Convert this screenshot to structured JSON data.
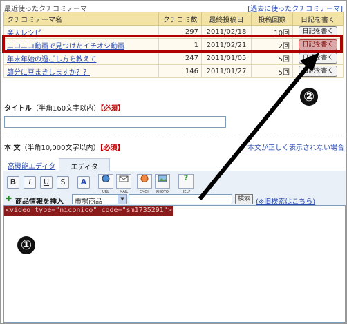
{
  "recent": {
    "title": "最近使ったクチコミテーマ",
    "bracket_open": "[",
    "link": "過去に使ったクチコミテーマ",
    "bracket_close": "]"
  },
  "table": {
    "headers": [
      "クチコミテーマ名",
      "クチコミ数",
      "最終投稿日",
      "投稿回数",
      "日記を書く"
    ],
    "rows": [
      {
        "name": "楽天レシピ",
        "count": "297",
        "date": "2011/02/18",
        "posts": "10回",
        "button": "日記を書く"
      },
      {
        "name": "ニコニコ動画で見つけたイチオシ動画",
        "count": "1",
        "date": "2011/02/21",
        "posts": "2回",
        "button": "日記を書く"
      },
      {
        "name": "年末年始の過ごし方を教えて",
        "count": "247",
        "date": "2011/01/05",
        "posts": "5回",
        "button": "日記を書く"
      },
      {
        "name": "節分に豆まきしますか？？",
        "count": "146",
        "date": "2011/01/27",
        "posts": "5回",
        "button": "日記を書く"
      }
    ]
  },
  "title_section": {
    "label": "タイトル",
    "hint": "（半角160文字以内）",
    "required": "【必須】"
  },
  "body_section": {
    "label": "本 文",
    "hint": "（半角10,000文字以内）",
    "required": "【必須】",
    "right_link": "本文が正しく表示されない場合"
  },
  "editor": {
    "tab_advanced": "高機能エディタ",
    "tab_simple": "エディタ",
    "buttons": [
      "B",
      "I",
      "U",
      "S",
      "A"
    ],
    "icon_buttons": [
      "URL",
      "MAIL",
      "EMOJI",
      "PHOTO",
      "HELP"
    ]
  },
  "product": {
    "label": "商品情報を挿入",
    "select_value": "市場商品",
    "search_button": "検索",
    "old_search": "(※旧検索はこちら)"
  },
  "body_content": "<video type=\"niconico\" code=\"sm1735291\">",
  "annotations": [
    "①",
    "②"
  ],
  "colors": {
    "highlight": "#b10000",
    "table_header": "#f3e3a6",
    "link": "#2a4cb0",
    "required": "#c00000"
  }
}
